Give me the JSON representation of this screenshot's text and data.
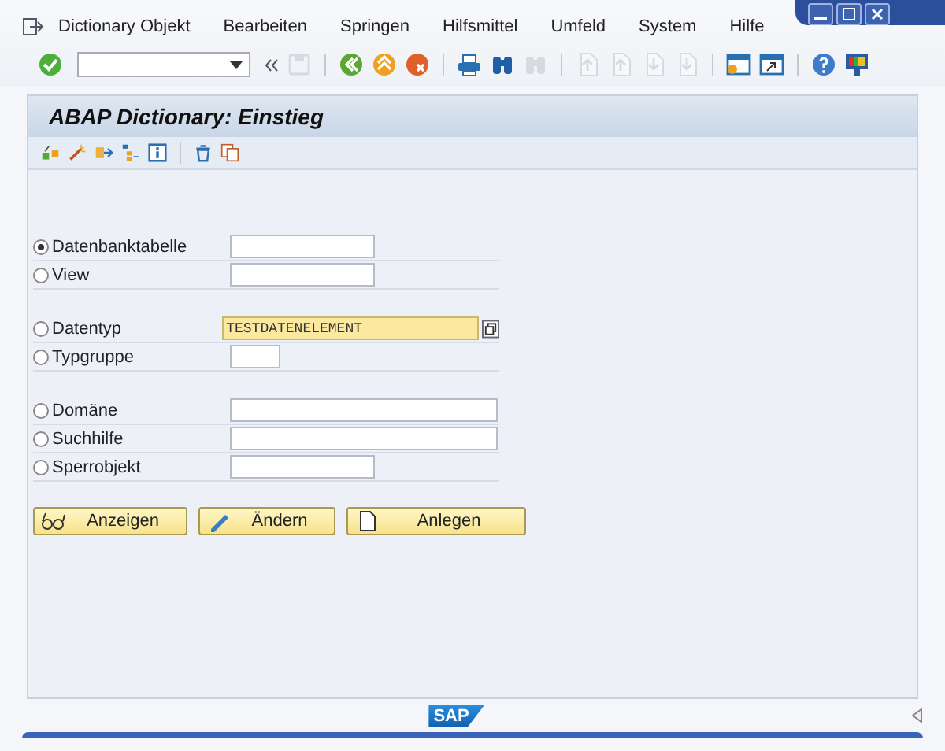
{
  "menu_bar": {
    "items": [
      "Dictionary Objekt",
      "Bearbeiten",
      "Springen",
      "Hilfsmittel",
      "Umfeld",
      "System",
      "Hilfe"
    ]
  },
  "toolbar": {
    "items": [
      {
        "kind": "enter",
        "disabled": false
      },
      {
        "kind": "command-field",
        "disabled": false
      },
      {
        "kind": "collapse",
        "disabled": false
      },
      {
        "kind": "save",
        "disabled": true
      },
      {
        "kind": "separator"
      },
      {
        "kind": "back",
        "disabled": false
      },
      {
        "kind": "exit",
        "disabled": false
      },
      {
        "kind": "cancel",
        "disabled": false
      },
      {
        "kind": "separator"
      },
      {
        "kind": "print",
        "disabled": false
      },
      {
        "kind": "find",
        "disabled": false
      },
      {
        "kind": "find-next",
        "disabled": true
      },
      {
        "kind": "separator"
      },
      {
        "kind": "first-page",
        "disabled": true
      },
      {
        "kind": "previous-page",
        "disabled": true
      },
      {
        "kind": "next-page",
        "disabled": true
      },
      {
        "kind": "last-page",
        "disabled": true
      },
      {
        "kind": "separator"
      },
      {
        "kind": "new-session",
        "disabled": false
      },
      {
        "kind": "shortcut",
        "disabled": false
      },
      {
        "kind": "separator"
      },
      {
        "kind": "help",
        "disabled": false
      },
      {
        "kind": "layout",
        "disabled": false
      }
    ]
  },
  "screen": {
    "title": "ABAP Dictionary: Einstieg",
    "app_toolbar": [
      {
        "kind": "other-object"
      },
      {
        "kind": "check"
      },
      {
        "kind": "activate"
      },
      {
        "kind": "where-used"
      },
      {
        "kind": "info"
      },
      {
        "kind": "separator"
      },
      {
        "kind": "delete"
      },
      {
        "kind": "copy"
      }
    ],
    "groups": [
      [
        {
          "label": "Datenbanktabelle",
          "selected": true,
          "focused": false
        },
        {
          "label": "View",
          "selected": false,
          "focused": false
        }
      ],
      [
        {
          "label": "Datentyp",
          "selected": false,
          "value": "TESTDATENELEMENT",
          "focused": true
        },
        {
          "label": "Typgruppe",
          "selected": false,
          "focused": false
        }
      ],
      [
        {
          "label": "Domäne",
          "selected": false,
          "focused": false
        },
        {
          "label": "Suchhilfe",
          "selected": false,
          "focused": false
        },
        {
          "label": "Sperrobjekt",
          "selected": false,
          "focused": false
        }
      ]
    ],
    "buttons": [
      {
        "kind": "display",
        "label": "Anzeigen"
      },
      {
        "kind": "change",
        "label": "Ändern"
      },
      {
        "kind": "create",
        "label": "Anlegen"
      }
    ]
  },
  "footer": {
    "logo": "SAP"
  }
}
